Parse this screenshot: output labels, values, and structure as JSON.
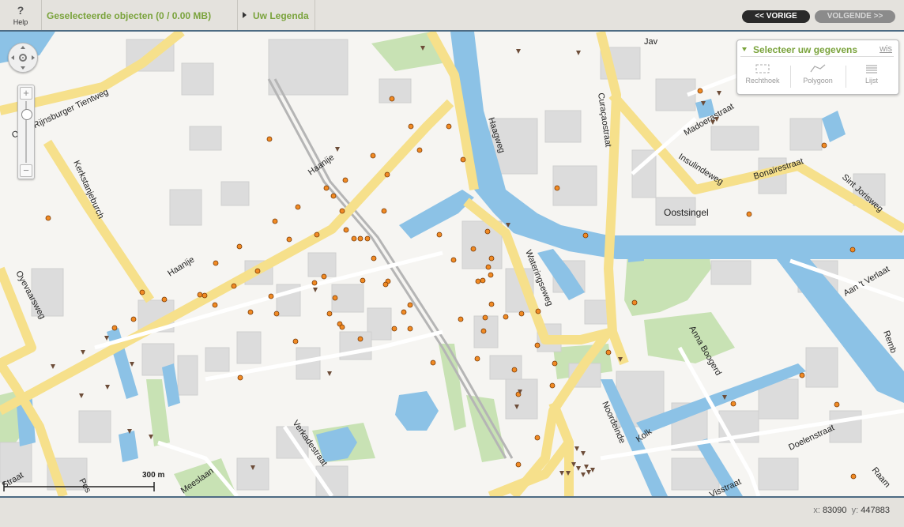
{
  "topbar": {
    "help_icon": "question-mark",
    "help_label": "Help",
    "selected_objects": "Geselecteerde objecten (0 / 0.00 MB)",
    "legend_label": "Uw Legenda",
    "prev_button": "<< VORIGE",
    "next_button": "VOLGENDE >>"
  },
  "select_panel": {
    "title": "Selecteer uw gegevens",
    "clear_link": "wis",
    "tools": [
      {
        "label": "Rechthoek",
        "icon": "rectangle-select-icon"
      },
      {
        "label": "Polygoon",
        "icon": "polygon-select-icon"
      },
      {
        "label": "Lijst",
        "icon": "list-icon"
      }
    ]
  },
  "map": {
    "street_labels": {
      "javastraat": "Jav",
      "madoerastraat": "Madoerastraat",
      "curacaostraat": "Curaçaostraat",
      "haagweg": "Haagweg",
      "insulindeweg": "Insulindeweg",
      "bonairestraat": "Bonairestraat",
      "sint_jorisweg": "Sint Jorisweg",
      "oostsingel": "Oostsingel",
      "aan_t_verlaat": "Aan 't Verlaat",
      "tientweg": "Oude Rijnsburger Tientweg",
      "tientweg_prefix": "Or",
      "haanije_1": "Haanije",
      "haanije_2": "Haanije",
      "kerkstanjeburch": "Kerkstanjeburch",
      "oyevaarsweg": "Oyevaarsweg",
      "wateringseweg": "Wateringseweg",
      "anna_boogerd": "Anna Boogerd",
      "rembrandt": "Remb",
      "noordeinde": "Noordeinde",
      "kolk": "Kolk",
      "doelenstraat": "Doelenstraat",
      "vissstraat": "Visstraat",
      "raam": "Raam",
      "verkadestraat": "Verkadestraat",
      "meeslaan": "Meeslaan",
      "straat_left": "Straat",
      "pes": "Pes"
    },
    "scale_label": "300 m"
  },
  "statusbar": {
    "x_label": "x:",
    "x_value": "83090",
    "y_label": "y:",
    "y_value": "447883"
  },
  "colors": {
    "accent_green": "#7aa33c",
    "water": "#8cc2e6",
    "main_road": "#f6e08b",
    "dot_orange": "#f08a24",
    "triangle_brown": "#6d4d39",
    "bar_border": "#4d6b83"
  }
}
